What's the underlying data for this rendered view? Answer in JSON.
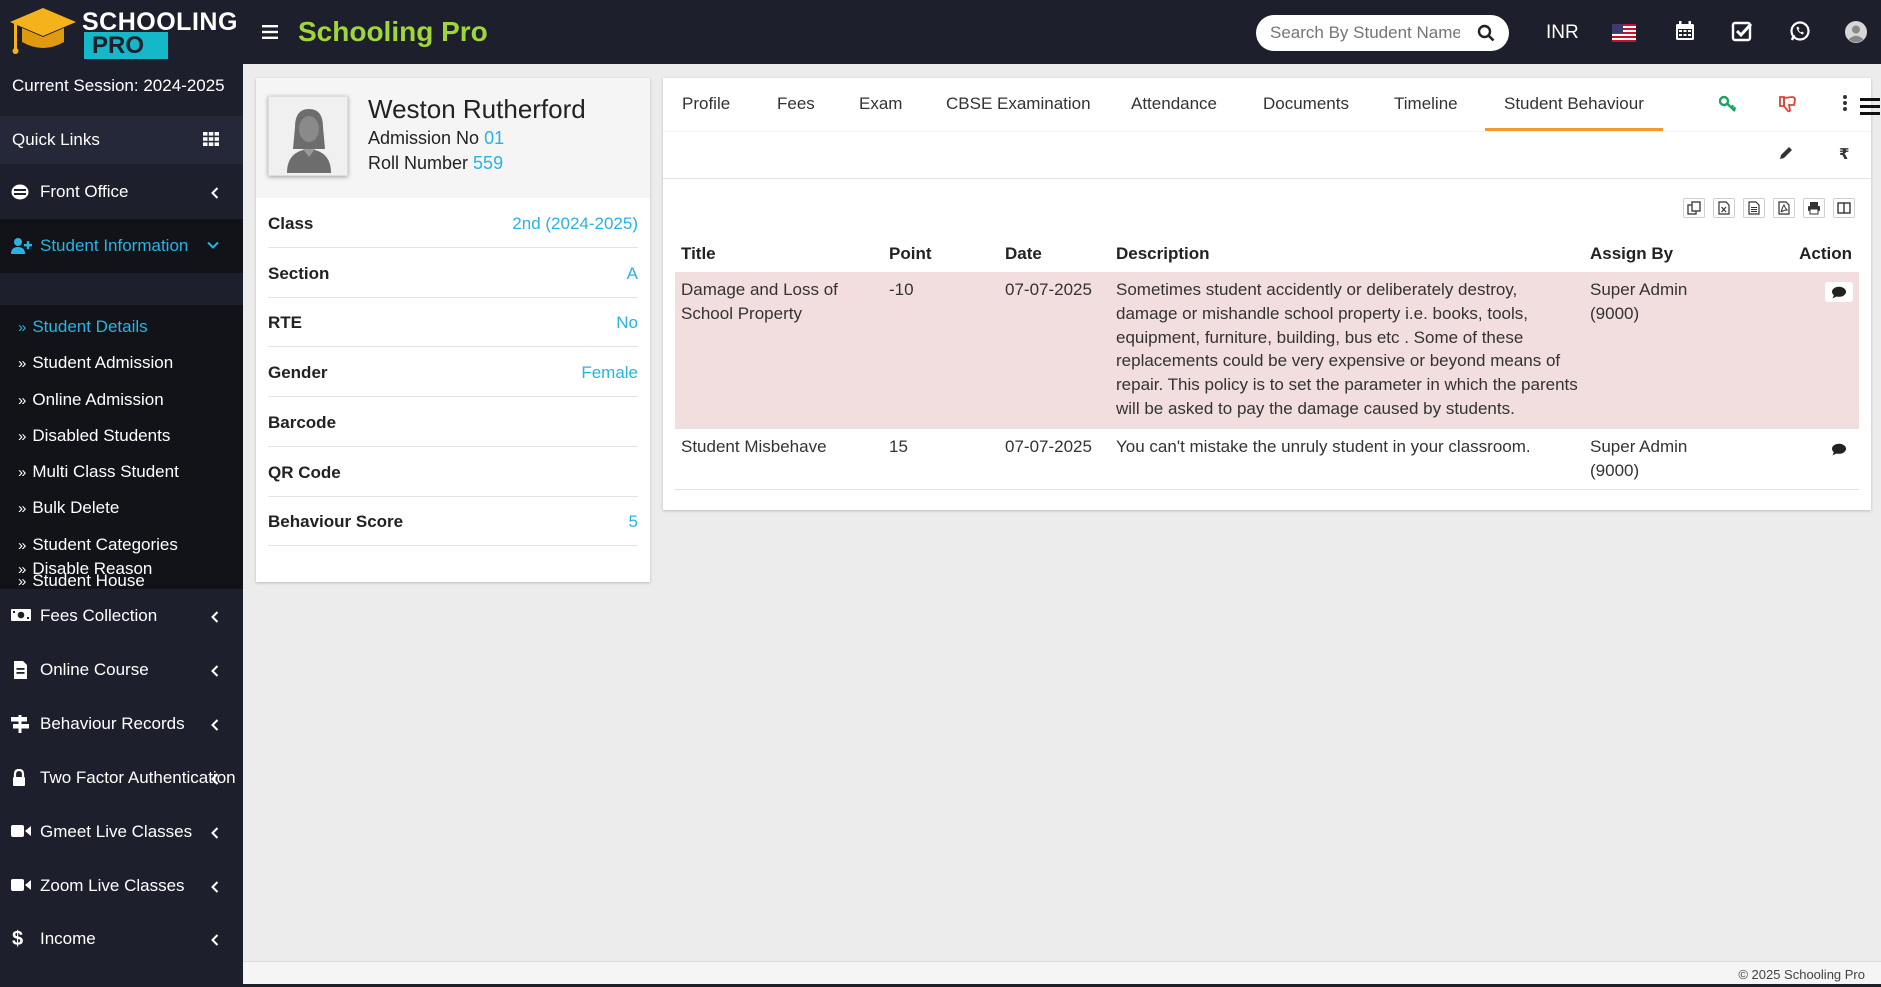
{
  "header": {
    "logo_top": "SCHOOLING",
    "logo_bottom": "PRO",
    "title": "Schooling Pro",
    "search_placeholder": "Search By Student Name",
    "currency": "INR"
  },
  "sidebar": {
    "session": "Current Session: 2024-2025",
    "quick_links": "Quick Links",
    "nav": [
      {
        "label": "Front Office",
        "icon": "front-office-icon"
      },
      {
        "label": "Student Information",
        "icon": "user-plus-icon"
      },
      {
        "label": "Fees Collection",
        "icon": "money-icon"
      },
      {
        "label": "Online Course",
        "icon": "file-icon"
      },
      {
        "label": "Behaviour Records",
        "icon": "signpost-icon"
      },
      {
        "label": "Two Factor Authentication",
        "icon": "lock-icon"
      },
      {
        "label": "Gmeet Live Classes",
        "icon": "video-icon"
      },
      {
        "label": "Zoom Live Classes",
        "icon": "video-icon"
      },
      {
        "label": "Income",
        "icon": "dollar-icon"
      }
    ],
    "submenu": [
      "Student Details",
      "Student Admission",
      "Online Admission",
      "Disabled Students",
      "Multi Class Student",
      "Bulk Delete",
      "Student Categories",
      "Student House",
      "Disable Reason"
    ]
  },
  "profile": {
    "name": "Weston Rutherford",
    "admission_label": "Admission No",
    "admission_no": "01",
    "roll_label": "Roll Number",
    "roll_no": "559",
    "rows": [
      {
        "key": "Class",
        "value": "2nd (2024-2025)"
      },
      {
        "key": "Section",
        "value": "A"
      },
      {
        "key": "RTE",
        "value": "No"
      },
      {
        "key": "Gender",
        "value": "Female"
      },
      {
        "key": "Barcode",
        "value": ""
      },
      {
        "key": "QR Code",
        "value": ""
      },
      {
        "key": "Behaviour Score",
        "value": "5"
      }
    ]
  },
  "tabs": [
    "Profile",
    "Fees",
    "Exam",
    "CBSE Examination",
    "Attendance",
    "Documents",
    "Timeline",
    "Student Behaviour"
  ],
  "table": {
    "headers": [
      "Title",
      "Point",
      "Date",
      "Description",
      "Assign By",
      "Action"
    ],
    "rows": [
      {
        "title_l1": "Damage and Loss of",
        "title_l2": "School Property",
        "point": "-10",
        "date": "07-07-2025",
        "desc_l1": "Sometimes student accidently or deliberately destroy,",
        "desc_l2": "damage or mishandle school property i.e. books, tools,",
        "desc_l3": "equipment, furniture, building, bus etc . Some of these",
        "desc_l4": "replacements could be very expensive or beyond means of",
        "desc_l5": "repair. This policy is to set the parameter in which the parents",
        "desc_l6": "will be asked to pay the damage caused by students.",
        "assign_l1": "Super Admin",
        "assign_l2": "(9000)"
      },
      {
        "title_l1": "Student Misbehave",
        "point": "15",
        "date": "07-07-2025",
        "desc_l1": "You can't mistake the unruly student in your classroom.",
        "assign_l1": "Super Admin",
        "assign_l2": "(9000)"
      }
    ]
  },
  "footer": "© 2025 Schooling Pro",
  "colors": {
    "dark": "#1d1f2c",
    "accent_blue": "#29b2e4",
    "title_green": "#9fd638",
    "tab_orange": "#f29a2e",
    "highlight_row": "#f2dede"
  }
}
